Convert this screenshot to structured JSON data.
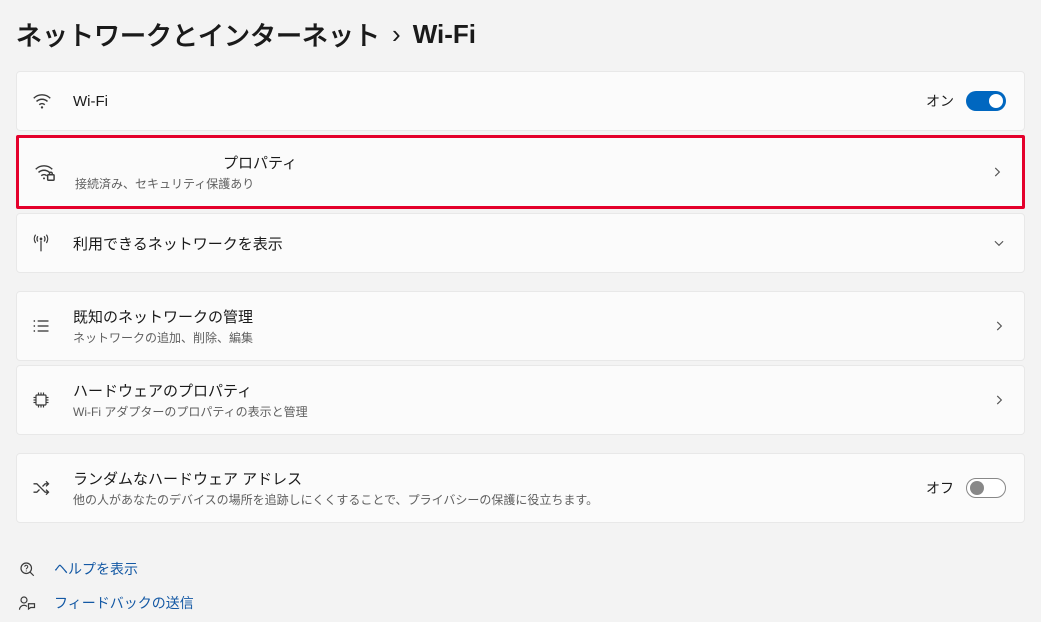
{
  "breadcrumb": {
    "parent": "ネットワークとインターネット",
    "sep": "›",
    "current": "Wi-Fi"
  },
  "wifi_row": {
    "label": "Wi-Fi",
    "state_label": "オン"
  },
  "properties_row": {
    "network_name": "",
    "label": "プロパティ",
    "subtitle": "接続済み、セキュリティ保護あり"
  },
  "available_row": {
    "label": "利用できるネットワークを表示"
  },
  "known_row": {
    "label": "既知のネットワークの管理",
    "subtitle": "ネットワークの追加、削除、編集"
  },
  "hardware_row": {
    "label": "ハードウェアのプロパティ",
    "subtitle": "Wi-Fi アダプターのプロパティの表示と管理"
  },
  "random_row": {
    "label": "ランダムなハードウェア アドレス",
    "subtitle": "他の人があなたのデバイスの場所を追跡しにくくすることで、プライバシーの保護に役立ちます。",
    "state_label": "オフ"
  },
  "footer": {
    "help": "ヘルプを表示",
    "feedback": "フィードバックの送信"
  }
}
